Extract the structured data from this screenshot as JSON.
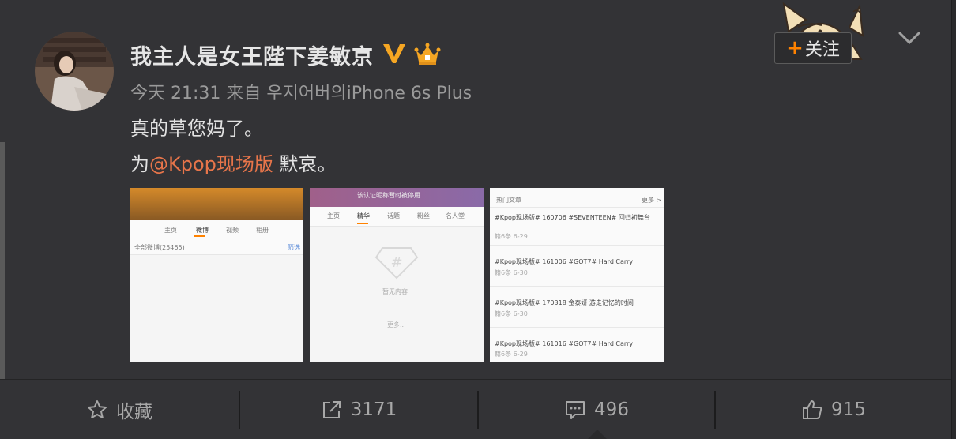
{
  "post": {
    "username": "我主人是女王陛下姜敏京",
    "time": "今天 21:31",
    "via_prefix": "来自",
    "source": "우지어버의iPhone 6s Plus",
    "line1": "真的草您妈了。",
    "line2_prefix": "为",
    "mention": "@Kpop现场版",
    "line2_suffix": " 默哀。"
  },
  "follow": {
    "plus": "+",
    "label": "关注"
  },
  "thumb1": {
    "tabs": [
      "主页",
      "微博",
      "视频",
      "相册"
    ],
    "row": "全部微博(25465)",
    "filter": "筛选"
  },
  "thumb2": {
    "banner": "该认证昵称暂时被停用",
    "tabs": [
      "主页",
      "精华",
      "话题",
      "粉丝",
      "名人堂"
    ],
    "empty": "暂无内容",
    "more": "更多..."
  },
  "thumb3": {
    "header": "热门文章",
    "more": "更多 >",
    "items": [
      {
        "title": "#Kpop现场版# 160706 #SEVENTEEN# 回归初舞台",
        "meta": "籍6条 6-29"
      },
      {
        "title": "#Kpop现场版# 161006 #GOT7# Hard Carry",
        "meta": "籍6条 6-30"
      },
      {
        "title": "#Kpop现场版# 170318 金泰妍 游走记忆的时间",
        "meta": "籍6条 6-30"
      },
      {
        "title": "#Kpop现场版# 161016 #GOT7# Hard Carry",
        "meta": "籍6条 6-29"
      }
    ]
  },
  "actions": {
    "favorite": "收藏",
    "repost": "3171",
    "comment": "496",
    "like": "915"
  },
  "colors": {
    "accent": "#ff8200",
    "mention": "#e8754a",
    "vip": "#f5a623"
  }
}
